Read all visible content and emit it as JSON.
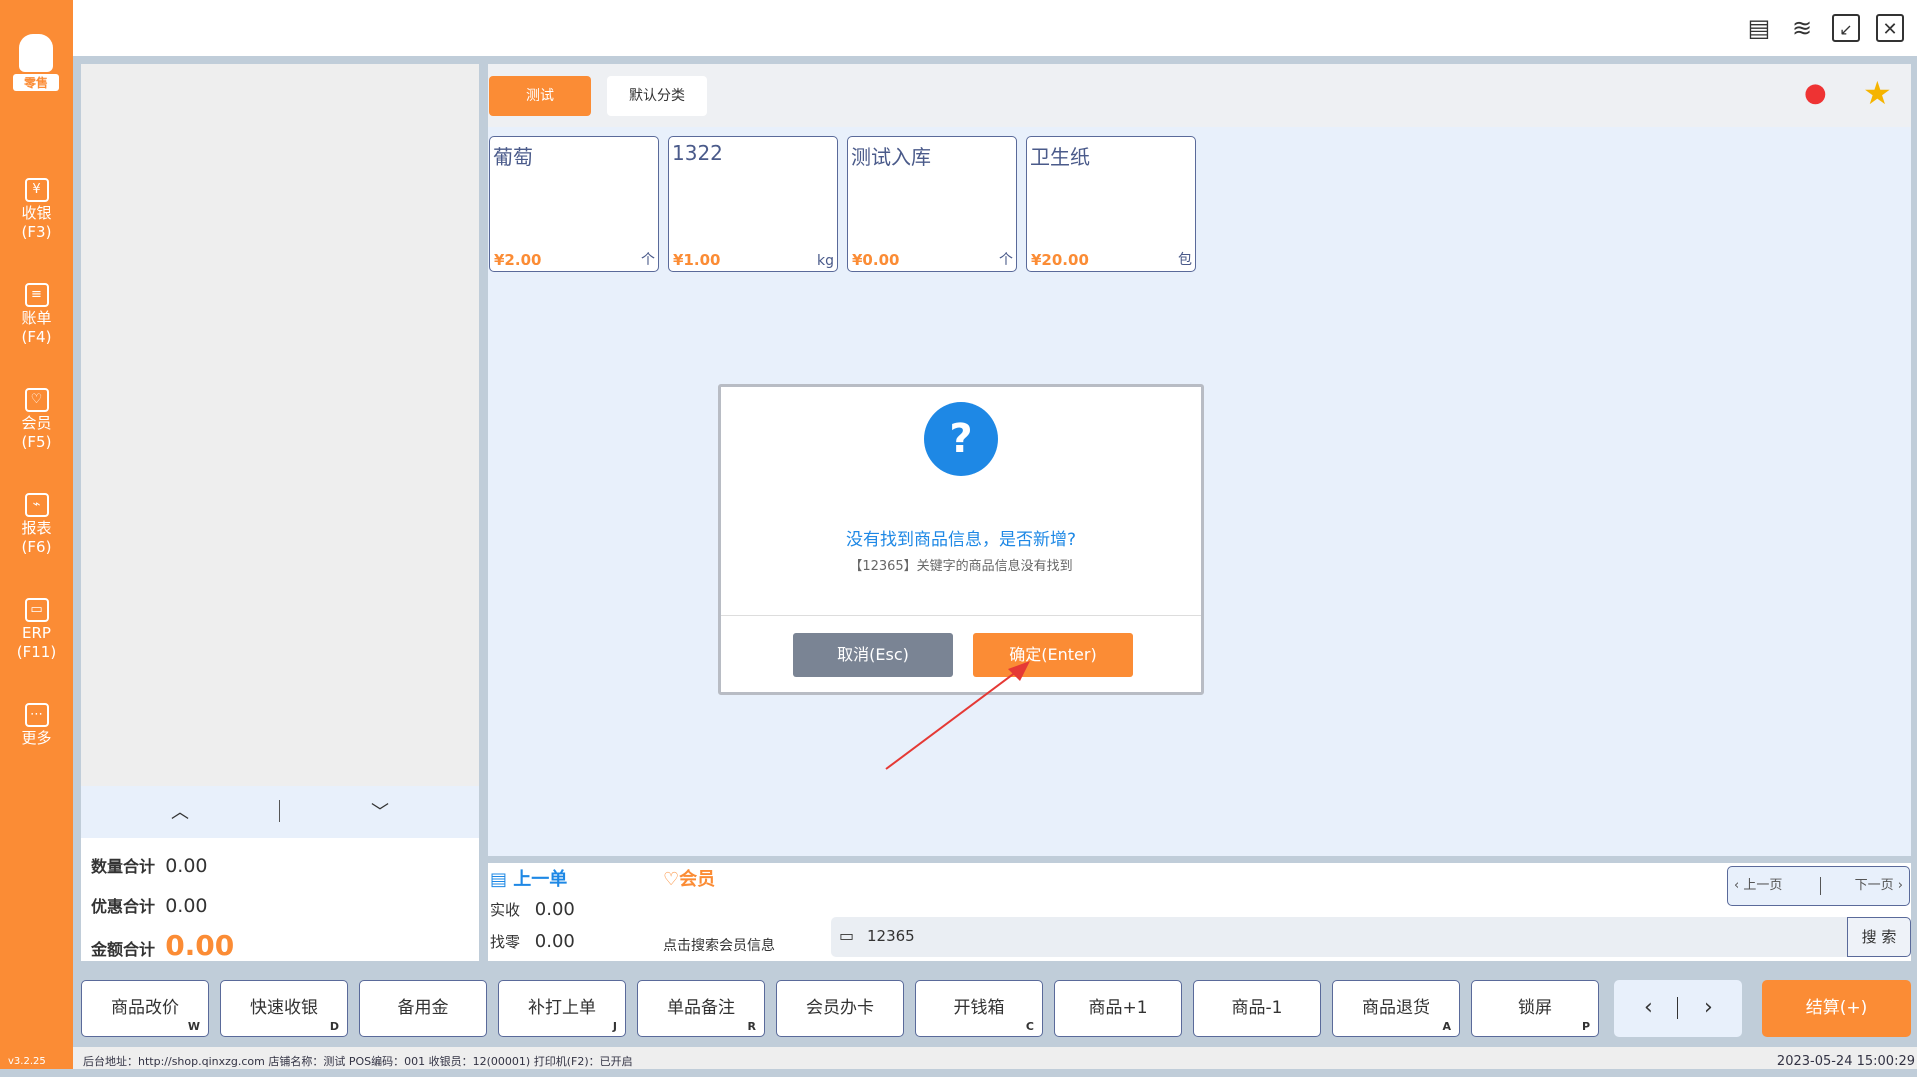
{
  "sidebar": {
    "logo_text": "零售",
    "items": [
      {
        "label": "收银",
        "key": "(F3)",
        "icon": "cashier-icon"
      },
      {
        "label": "账单",
        "key": "(F4)",
        "icon": "bill-icon"
      },
      {
        "label": "会员",
        "key": "(F5)",
        "icon": "member-icon"
      },
      {
        "label": "报表",
        "key": "(F6)",
        "icon": "report-icon"
      },
      {
        "label": "ERP",
        "key": "(F11)",
        "icon": "erp-icon"
      },
      {
        "label": "更多",
        "key": "",
        "icon": "more-icon"
      }
    ],
    "version": "v3.2.25"
  },
  "categories": [
    {
      "label": "测试",
      "active": true
    },
    {
      "label": "默认分类",
      "active": false
    }
  ],
  "products": [
    {
      "name": "葡萄",
      "price": "¥2.00",
      "unit": "个"
    },
    {
      "name": "1322",
      "price": "¥1.00",
      "unit": "kg"
    },
    {
      "name": "测试入库",
      "price": "¥0.00",
      "unit": "个"
    },
    {
      "name": "卫生纸",
      "price": "¥20.00",
      "unit": "包"
    }
  ],
  "totals": {
    "qty_label": "数量合计",
    "qty": "0.00",
    "discount_label": "优惠合计",
    "discount": "0.00",
    "amount_label": "金额合计",
    "amount": "0.00"
  },
  "info": {
    "last_order": "上一单",
    "member": "会员",
    "received_label": "实收",
    "received": "0.00",
    "change_label": "找零",
    "change": "0.00",
    "member_search": "点击搜索会员信息",
    "prev_page": "上一页",
    "next_page": "下一页",
    "search_value": "12365",
    "search_btn": "搜 索"
  },
  "buttons": [
    {
      "label": "商品改价",
      "key": "W"
    },
    {
      "label": "快速收银",
      "key": "D"
    },
    {
      "label": "备用金",
      "key": ""
    },
    {
      "label": "补打上单",
      "key": "J"
    },
    {
      "label": "单品备注",
      "key": "R"
    },
    {
      "label": "会员办卡",
      "key": ""
    },
    {
      "label": "开钱箱",
      "key": "C"
    },
    {
      "label": "商品+1",
      "key": ""
    },
    {
      "label": "商品-1",
      "key": ""
    },
    {
      "label": "商品退货",
      "key": "A"
    },
    {
      "label": "锁屏",
      "key": "P"
    }
  ],
  "settle": "结算(+)",
  "dialog": {
    "title": "没有找到商品信息，是否新增?",
    "subtitle": "【12365】关键字的商品信息没有找到",
    "cancel": "取消(Esc)",
    "confirm": "确定(Enter)"
  },
  "status": {
    "text": "后台地址：http://shop.qinxzg.com  店铺名称：测试  POS编码：001  收银员：12(00001)  打印机(F2)：已开启",
    "datetime": "2023-05-24 15:00:29"
  }
}
